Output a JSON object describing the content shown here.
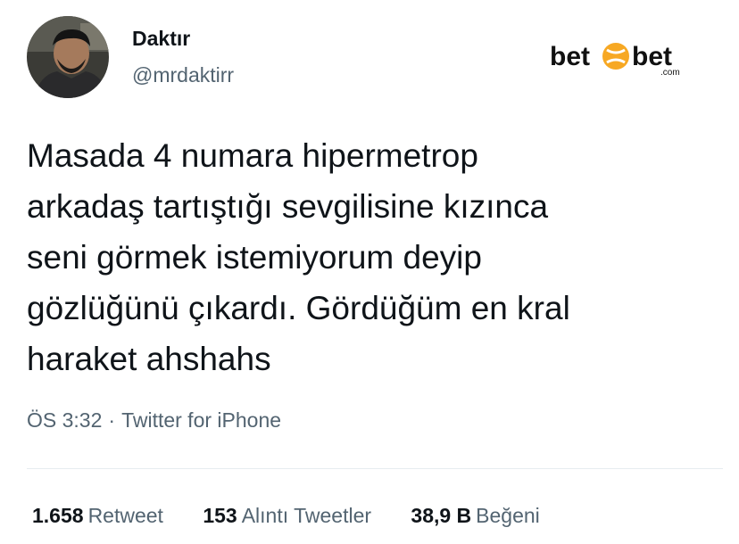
{
  "author": {
    "display_name": "Daktır",
    "handle": "@mrdaktirr",
    "avatar_icon": "user-avatar-photo"
  },
  "brand": {
    "part1": "bet",
    "part2": "bet",
    "suffix": ".com",
    "emblem_icon": "orange-ball-icon",
    "accent_color": "#f7a823"
  },
  "tweet": {
    "lines": [
      "Masada 4 numara hipermetrop",
      "arkadaş tartıştığı sevgilisine kızınca",
      "seni görmek istemiyorum deyip",
      "gözlüğünü çıkardı. Gördüğüm en kral",
      "haraket ahshahs"
    ],
    "time": "ÖS 3:32",
    "separator": "·",
    "source": "Twitter for iPhone"
  },
  "stats": [
    {
      "count": "1.658",
      "label": "Retweet"
    },
    {
      "count": "153",
      "label": "Alıntı Tweetler"
    },
    {
      "count": "38,9 B",
      "label": "Beğeni"
    }
  ]
}
